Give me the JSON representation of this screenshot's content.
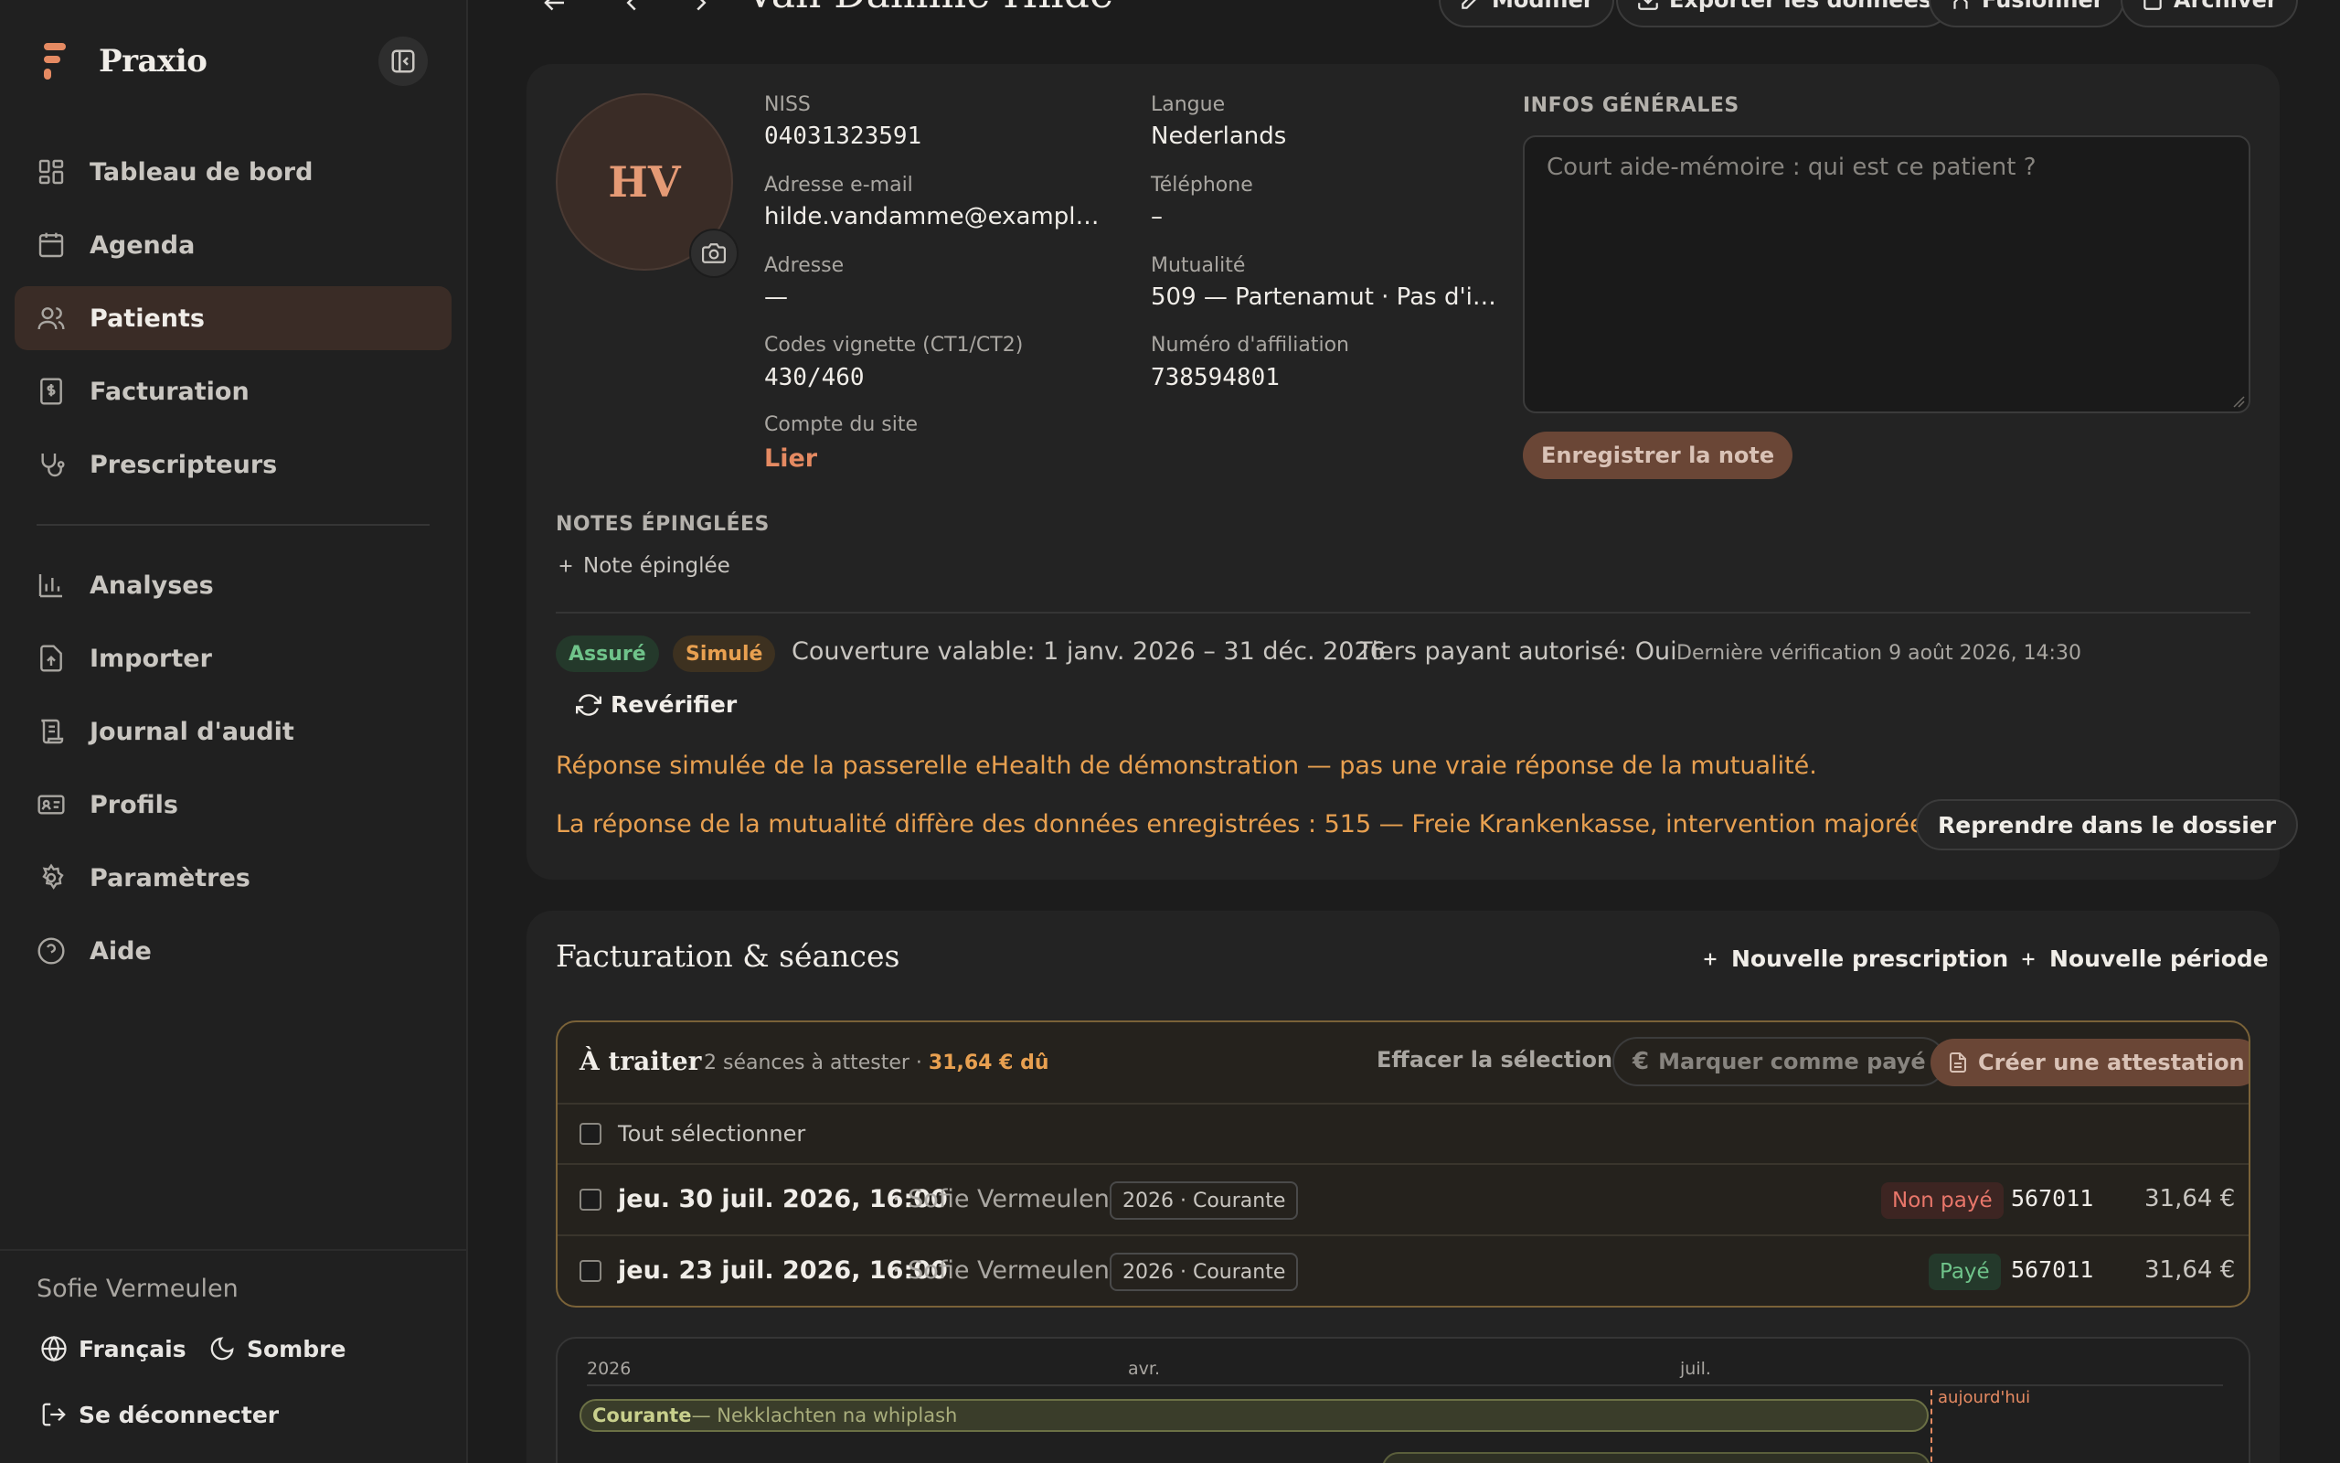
{
  "app": {
    "name": "Praxio"
  },
  "sidebar": {
    "items": [
      {
        "label": "Tableau de bord",
        "icon": "dashboard-icon"
      },
      {
        "label": "Agenda",
        "icon": "calendar-icon"
      },
      {
        "label": "Patients",
        "icon": "users-icon",
        "active": true
      },
      {
        "label": "Facturation",
        "icon": "invoice-icon"
      },
      {
        "label": "Prescripteurs",
        "icon": "stethoscope-icon"
      },
      {
        "label": "Analyses",
        "icon": "bar-chart-icon"
      },
      {
        "label": "Importer",
        "icon": "upload-icon"
      },
      {
        "label": "Journal d'audit",
        "icon": "scroll-icon"
      },
      {
        "label": "Profils",
        "icon": "id-card-icon"
      },
      {
        "label": "Paramètres",
        "icon": "gear-icon"
      },
      {
        "label": "Aide",
        "icon": "help-icon"
      }
    ],
    "footer": {
      "user": "Sofie Vermeulen",
      "language": "Français",
      "theme": "Sombre",
      "logout": "Se déconnecter"
    }
  },
  "header": {
    "title": "Van Damme Hilde",
    "buttons": {
      "edit": "Modifier",
      "export": "Exporter les données",
      "merge": "Fusionner",
      "archive": "Archiver"
    }
  },
  "patient": {
    "initials": "HV",
    "fields": {
      "niss_label": "NISS",
      "niss": "04031323591",
      "email_label": "Adresse e-mail",
      "email": "hilde.vandamme@example....",
      "address_label": "Adresse",
      "address": "—",
      "vignette_label": "Codes vignette (CT1/CT2)",
      "vignette": "430/460",
      "site_label": "Compte du site",
      "site_link": "Lier",
      "language_label": "Langue",
      "language": "Nederlands",
      "phone_label": "Téléphone",
      "phone": "–",
      "mutuality_label": "Mutualité",
      "mutuality": "509 — Partenamut · Pas d'in...",
      "affiliation_label": "Numéro d'affiliation",
      "affiliation": "738594801"
    },
    "general_info": {
      "title": "INFOS GÉNÉRALES",
      "placeholder": "Court aide-mémoire : qui est ce patient ?",
      "save": "Enregistrer la note"
    },
    "pinned": {
      "title": "NOTES ÉPINGLÉES",
      "add": "Note épinglée"
    }
  },
  "insurance": {
    "badge_insured": "Assuré",
    "badge_simulated": "Simulé",
    "coverage": "Couverture valable: 1 janv. 2026 – 31 déc. 2026",
    "third_party": "Tiers payant autorisé: Oui",
    "last_check": "Dernière vérification 9 août 2026, 14:30",
    "recheck": "Revérifier",
    "simulated_note": "Réponse simulée de la passerelle eHealth de démonstration — pas une vraie réponse de la mutualité.",
    "diff_note": "La réponse de la mutualité diffère des données enregistrées : 515 — Freie Krankenkasse, intervention majorée : Non.",
    "apply": "Reprendre dans le dossier"
  },
  "billing": {
    "title": "Facturation & séances",
    "new_prescription": "Nouvelle prescription",
    "new_period": "Nouvelle période",
    "todo": {
      "title": "À traiter",
      "summary": "2 séances à attester · ",
      "due": "31,64 € dû",
      "clear": "Effacer la sélection",
      "mark_paid": "Marquer comme payé",
      "create_attestation": "Créer une attestation",
      "select_all": "Tout sélectionner"
    },
    "sessions": [
      {
        "date": "jeu. 30 juil. 2026, 16:00",
        "therapist": "· Sofie Vermeulen",
        "tag": "2026 · Courante",
        "status": "Non payé",
        "code": "567011",
        "amount": "31,64 €"
      },
      {
        "date": "jeu. 23 juil. 2026, 16:00",
        "therapist": "· Sofie Vermeulen",
        "tag": "2026 · Courante",
        "status": "Payé",
        "code": "567011",
        "amount": "31,64 €"
      }
    ],
    "timeline": {
      "ticks": [
        "2026",
        "avr.",
        "juil."
      ],
      "today": "aujourd'hui",
      "period_name": "Courante",
      "period_desc": " — Nekklachten na whiplash"
    }
  },
  "colors": {
    "accent": "#e58a62",
    "warning": "#e8a050",
    "success": "#6fc38a",
    "danger": "#e8766a"
  }
}
